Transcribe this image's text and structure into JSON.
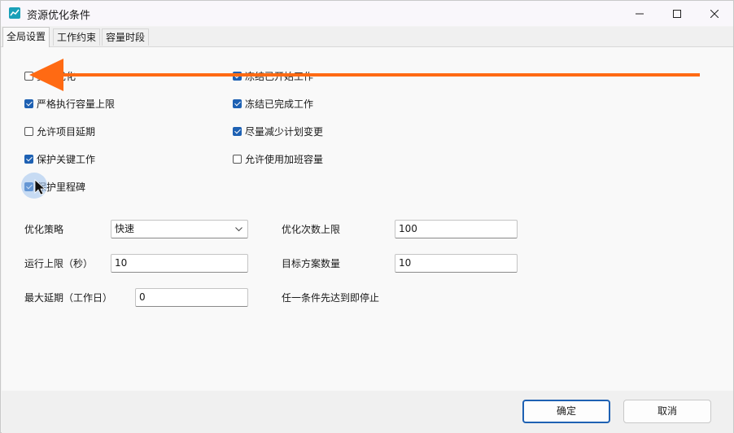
{
  "window": {
    "title": "资源优化条件"
  },
  "tabs": [
    {
      "label": "全局设置"
    },
    {
      "label": "工作约束"
    },
    {
      "label": "容量时段"
    }
  ],
  "checkboxes_left": [
    {
      "label": "资源优化",
      "checked": false
    },
    {
      "label": "严格执行容量上限",
      "checked": true
    },
    {
      "label": "允许项目延期",
      "checked": false
    },
    {
      "label": "保护关键工作",
      "checked": true
    },
    {
      "label": "保护里程碑",
      "checked": true
    }
  ],
  "checkboxes_right": [
    {
      "label": "冻结已开始工作",
      "checked": true
    },
    {
      "label": "冻结已完成工作",
      "checked": true
    },
    {
      "label": "尽量减少计划变更",
      "checked": true
    },
    {
      "label": "允许使用加班容量",
      "checked": false
    }
  ],
  "settings": {
    "strategy_label": "优化策略",
    "strategy_value": "快速",
    "iterations_label": "优化次数上限",
    "iterations_value": "100",
    "runtime_label": "运行上限（秒）",
    "runtime_value": "10",
    "targets_label": "目标方案数量",
    "targets_value": "10",
    "delay_label": "最大延期（工作日）",
    "delay_value": "0",
    "stop_note": "任一条件先达到即停止"
  },
  "buttons": {
    "ok": "确定",
    "cancel": "取消"
  },
  "colors": {
    "accent": "#1e61b3",
    "arrow": "#ff6a13",
    "app_icon": "#1aa0b8"
  }
}
